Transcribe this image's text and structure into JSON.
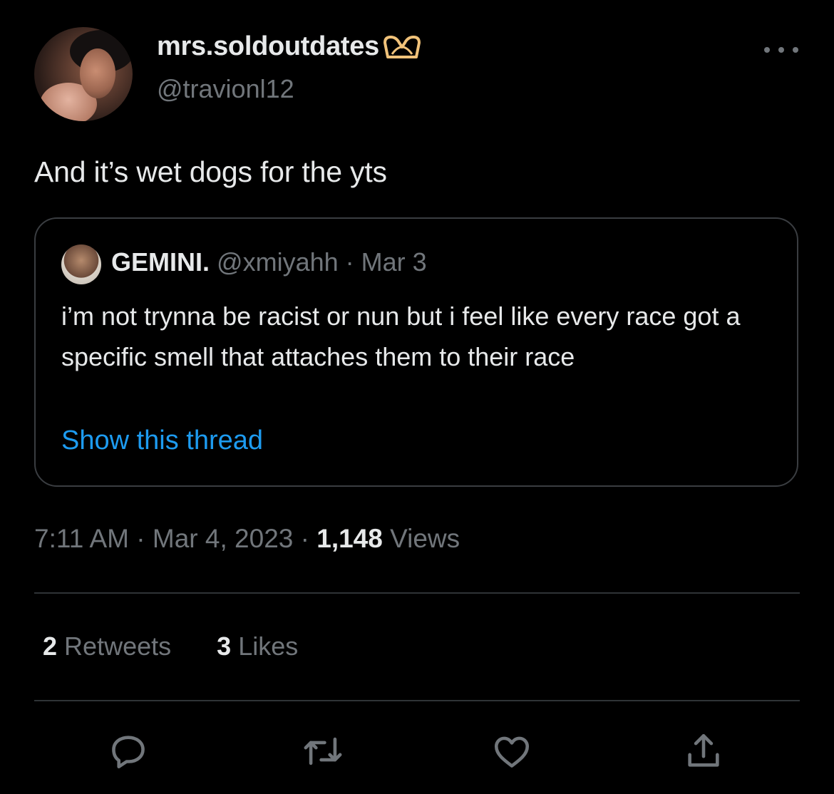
{
  "author": {
    "display_name": "mrs.soldoutdates",
    "handle": "@travionl12",
    "name_emoji": "heart-hands-icon"
  },
  "tweet": {
    "text": "And it’s wet dogs for the yts"
  },
  "quoted_tweet": {
    "name": "GEMINI.",
    "handle": "@xmiyahh",
    "separator": "·",
    "date": "Mar 3",
    "text": "i’m not trynna be racist or nun but i feel like  every race got a specific smell that attaches them to their race",
    "show_thread_label": "Show this thread"
  },
  "meta": {
    "time": "7:11 AM",
    "separator": "·",
    "date": "Mar 4, 2023",
    "views_count": "1,148",
    "views_label": "Views"
  },
  "stats": {
    "retweets_count": "2",
    "retweets_label": "Retweets",
    "likes_count": "3",
    "likes_label": "Likes"
  },
  "actions": [
    "reply-icon",
    "retweet-icon",
    "like-icon",
    "share-icon"
  ],
  "colors": {
    "background": "#000000",
    "text": "#e7e9ea",
    "secondary": "#71767b",
    "link": "#1d9bf0",
    "border": "#2f3336"
  }
}
